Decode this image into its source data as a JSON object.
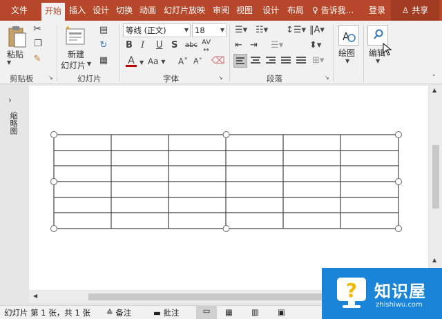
{
  "menu": {
    "file": "文件",
    "home": "开始",
    "insert": "插入",
    "design": "设计",
    "transitions": "切换",
    "animations": "动画",
    "slideshow": "幻灯片放映",
    "review": "审阅",
    "view": "视图",
    "table_design": "设计",
    "layout": "布局",
    "tell_me": "告诉我...",
    "login": "登录",
    "share": "共享"
  },
  "ribbon": {
    "paste": "粘贴",
    "clipboard_group": "剪贴板",
    "new_slide_line1": "新建",
    "new_slide_line2": "幻灯片",
    "slides_group": "幻灯片",
    "font_name": "等线 (正文)",
    "font_size": "18",
    "font_group": "字体",
    "paragraph_group": "段落",
    "drawing": "绘图",
    "editing": "编辑"
  },
  "sidebar": {
    "thumbnails_label": "缩略图"
  },
  "table": {
    "rows": 6,
    "cols": 6
  },
  "status": {
    "slide_info": "幻灯片 第 1 张，共 1 张",
    "notes": "备注",
    "comments": "批注"
  },
  "watermark": {
    "brand": "知识屋",
    "url": "zhishiwu.com"
  },
  "colors": {
    "accent": "#b7472a",
    "font_color_bar": "#c00000",
    "watermark_bg": "#1a85d8"
  }
}
